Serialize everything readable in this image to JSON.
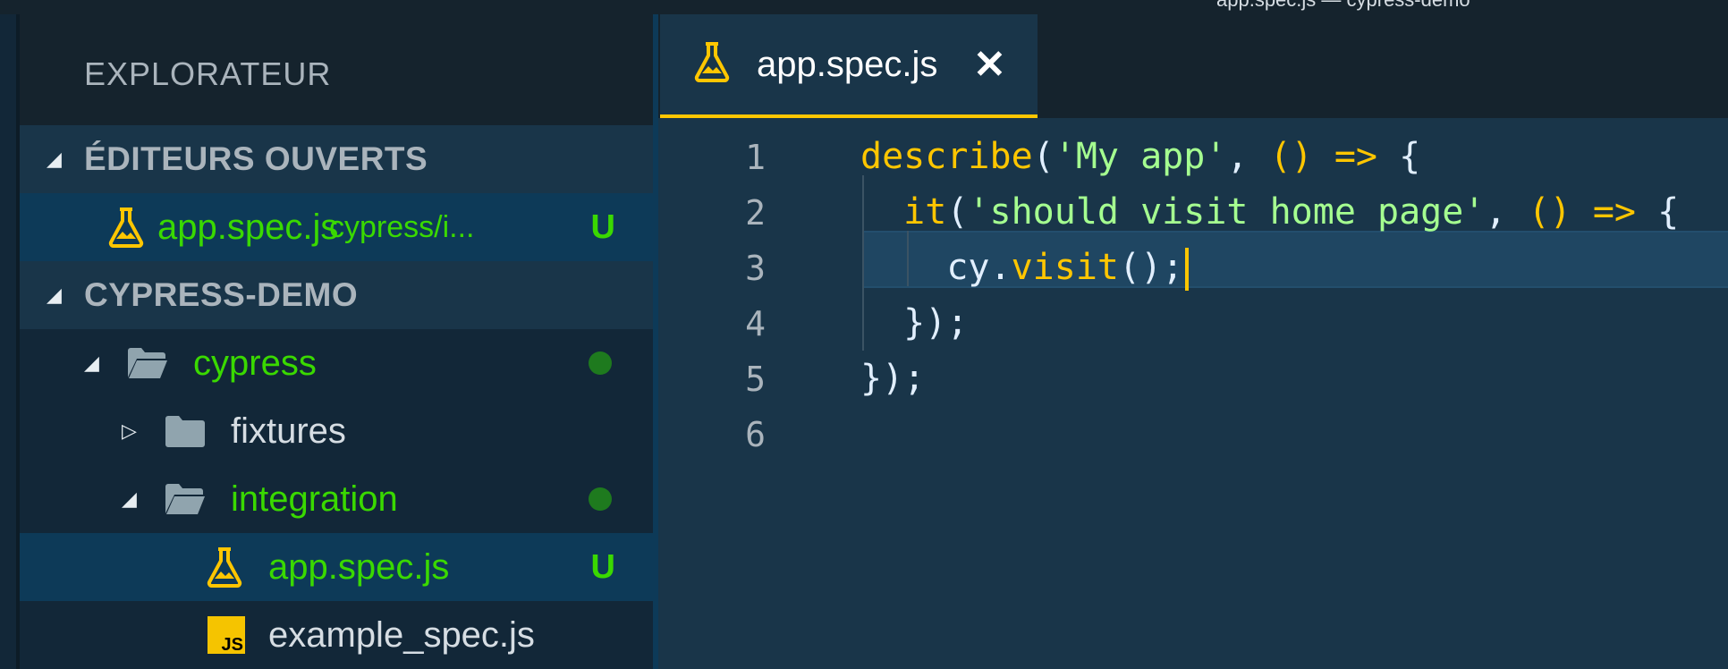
{
  "titlebar": {
    "text": "app.spec.js — cypress-demo"
  },
  "explorer": {
    "title": "EXPLORATEUR",
    "open_editors": {
      "header": "ÉDITEURS OUVERTS",
      "items": [
        {
          "name": "app.spec.js",
          "path": "cypress/i...",
          "status": "U",
          "icon": "cypress-flask-icon"
        }
      ]
    },
    "project": {
      "header": "CYPRESS-DEMO",
      "tree": [
        {
          "name": "cypress",
          "type": "folder-open",
          "modified": true
        },
        {
          "name": "fixtures",
          "type": "folder-closed",
          "modified": false
        },
        {
          "name": "integration",
          "type": "folder-open",
          "modified": true
        },
        {
          "name": "app.spec.js",
          "type": "cypress-file",
          "status": "U"
        },
        {
          "name": "example_spec.js",
          "type": "js-file"
        }
      ]
    }
  },
  "editor": {
    "tab": {
      "label": "app.spec.js",
      "close": "✕"
    },
    "line_numbers": [
      "1",
      "2",
      "3",
      "4",
      "5",
      "6"
    ],
    "lines": {
      "l1": {
        "fn": "describe",
        "open": "(",
        "str": "'My app'",
        "comma": ", ",
        "args": "()",
        "arrow": " => ",
        "brace": "{"
      },
      "l2": {
        "indent": "  ",
        "fn": "it",
        "open": "(",
        "str": "'should visit home page'",
        "comma": ", ",
        "args": "()",
        "arrow": " => ",
        "brace": "{"
      },
      "l3": {
        "indent": "    ",
        "obj": "cy",
        "dot": ".",
        "method": "visit",
        "call": "();"
      },
      "l4": {
        "indent": "  ",
        "close": "});"
      },
      "l5": {
        "close": "});"
      },
      "l6": {
        "text": ""
      }
    },
    "colors": {
      "keyword": "#ffc600",
      "string": "#a5ff90",
      "background": "#193549",
      "git_untracked": "#3ad900"
    }
  }
}
